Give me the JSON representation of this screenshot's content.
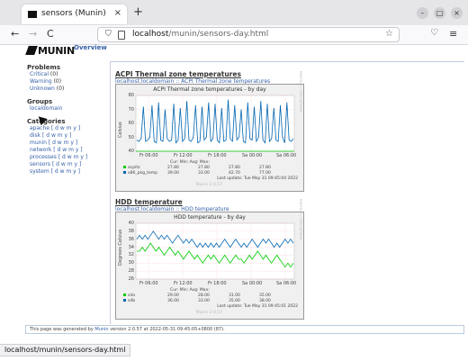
{
  "browser": {
    "tab_title": "sensors (Munin)",
    "tab_close": "×",
    "new_tab": "+",
    "back": "←",
    "forward": "→",
    "reload": "C",
    "url_host": "localhost",
    "url_path": "/munin/sensors-day.html",
    "bookmark_star": "☆",
    "pocket": "♡",
    "menu": "≡",
    "win_min": "–",
    "win_max": "□",
    "win_close": "×",
    "status_url": "localhost/munin/sensors-day.html"
  },
  "munin": {
    "logo_text": "MUNIN",
    "overview": "Overview"
  },
  "sidebar": {
    "problems_heading": "Problems",
    "problems": [
      {
        "label": "Critical",
        "count": "(0)"
      },
      {
        "label": "Warning",
        "count": "(0)"
      },
      {
        "label": "Unknown",
        "count": "(0)"
      }
    ],
    "groups_heading": "Groups",
    "groups": [
      "localdomain"
    ],
    "categories_heading": "Categories",
    "categories": [
      {
        "name": "apache",
        "periods": "[ d w m y ]"
      },
      {
        "name": "disk",
        "periods": "[ d w m y ]"
      },
      {
        "name": "munin",
        "periods": "[ d w m y ]"
      },
      {
        "name": "network",
        "periods": "[ d w m y ]"
      },
      {
        "name": "processes",
        "periods": "[ d w m y ]"
      },
      {
        "name": "sensors",
        "periods": "[ d w m y ]"
      },
      {
        "name": "system",
        "periods": "[ d w m y ]"
      }
    ]
  },
  "sections": [
    {
      "title": "ACPI Thermal zone temperatures",
      "crumb": "localhost.localdomain :: ACPI Thermal zone temperatures"
    },
    {
      "title": "HDD temperature",
      "crumb": "localhost.localdomain :: HDD temperature"
    }
  ],
  "chart_data": [
    {
      "type": "line",
      "title": "ACPI Thermal zone temperatures - by day",
      "ylabel": "Celsius",
      "ylim": [
        40,
        80
      ],
      "yticks": [
        "80",
        "70",
        "60",
        "50",
        "40"
      ],
      "xticks": [
        "Fr 06:00",
        "Fr 12:00",
        "Fr 18:00",
        "Sa 00:00",
        "Sa 06:00"
      ],
      "legend_header": [
        "Cur:",
        "Min:",
        "Avg:",
        "Max:"
      ],
      "series": [
        {
          "name": "acpitz",
          "color": "#00cc00",
          "cur": "27.80",
          "min": "27.80",
          "avg": "27.80",
          "max": "27.80",
          "values": [
            27.8,
            27.8,
            27.8,
            27.8
          ]
        },
        {
          "name": "x86_pkg_temp",
          "color": "#0066b3",
          "cur": "39.00",
          "min": "33.00",
          "avg": "42.70",
          "max": "77.00",
          "values": [
            48,
            47,
            49,
            72,
            47,
            48,
            50,
            73,
            47,
            46,
            75,
            48,
            47,
            70,
            49,
            47,
            48,
            74,
            46,
            48,
            71,
            47,
            49,
            76,
            48,
            47,
            50,
            73,
            46,
            47,
            72,
            48,
            50,
            75,
            47,
            49,
            74,
            48,
            46,
            71,
            47,
            48,
            77,
            49,
            47,
            73,
            48,
            50,
            70,
            47,
            46,
            75,
            49,
            48,
            72,
            47,
            50,
            76,
            48,
            46,
            74,
            47,
            49,
            71,
            48,
            47,
            73,
            50,
            46,
            75,
            48,
            47,
            49
          ]
        }
      ],
      "update": "Last update: Tue May 31 09:45:04 2022",
      "side_text": "RRDTOOL / TOBI OETIKER",
      "footer_text": "Munin 2.0.57"
    },
    {
      "type": "line",
      "title": "HDD temperature - by day",
      "ylabel": "Degrees Celsius",
      "ylim": [
        26,
        40
      ],
      "yticks": [
        "40",
        "38",
        "36",
        "34",
        "32",
        "30",
        "28",
        "26"
      ],
      "xticks": [
        "Fr 06:00",
        "Fr 12:00",
        "Fr 18:00",
        "Sa 00:00",
        "Sa 06:00"
      ],
      "legend_header": [
        "Cur:",
        "Min:",
        "Avg:",
        "Max:"
      ],
      "series": [
        {
          "name": "sda",
          "color": "#00cc00",
          "cur": "29.00",
          "min": "28.00",
          "avg": "31.00",
          "max": "35.00",
          "values": [
            33,
            33,
            34,
            33,
            34,
            35,
            34,
            33,
            34,
            33,
            32,
            33,
            34,
            33,
            32,
            33,
            32,
            31,
            32,
            33,
            32,
            31,
            32,
            31,
            30,
            31,
            32,
            31,
            32,
            31,
            30,
            31,
            32,
            31,
            30,
            31,
            32,
            31,
            31,
            30,
            31,
            32,
            31,
            32,
            33,
            32,
            31,
            32,
            31,
            30,
            31,
            32,
            31,
            30,
            29,
            30,
            29,
            30
          ]
        },
        {
          "name": "sdb",
          "color": "#0066b3",
          "cur": "36.00",
          "min": "33.00",
          "avg": "35.00",
          "max": "38.00",
          "values": [
            36,
            37,
            36,
            37,
            36,
            37,
            38,
            37,
            36,
            37,
            36,
            37,
            36,
            35,
            36,
            37,
            36,
            35,
            36,
            35,
            36,
            35,
            34,
            35,
            34,
            35,
            34,
            35,
            34,
            35,
            34,
            35,
            36,
            35,
            34,
            35,
            36,
            35,
            34,
            35,
            34,
            35,
            36,
            35,
            34,
            35,
            36,
            35,
            36,
            35,
            34,
            35,
            34,
            35,
            36,
            35,
            36,
            35
          ]
        }
      ],
      "update": "Last update: Tue May 31 09:45:01 2022",
      "side_text": "RRDTOOL / TOBI OETIKER",
      "footer_text": "Munin 2.0.57"
    }
  ],
  "footer": {
    "prefix": "This page was generated by",
    "link": "Munin",
    "suffix": "version 2.0.57 at 2022-05-31 09:45:05+0800 (87)."
  }
}
